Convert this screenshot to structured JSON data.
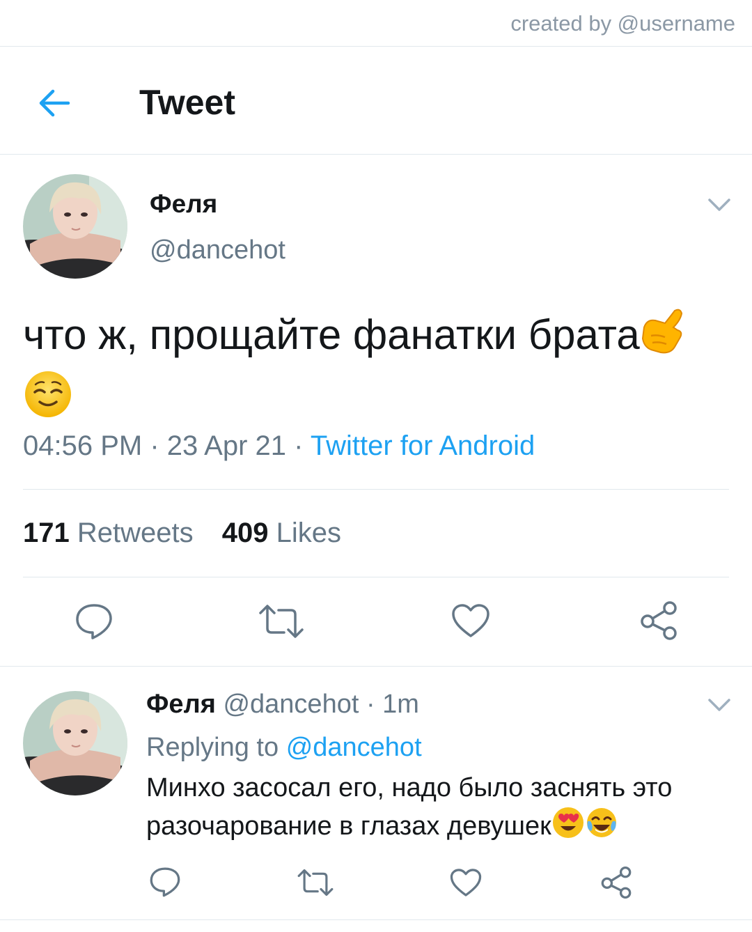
{
  "credit": "created by @username",
  "header": {
    "title": "Tweet",
    "back_icon": "arrow-left-icon"
  },
  "tweet": {
    "author_name": "Феля",
    "author_handle": "@dancehot",
    "text": "что ж, прощайте фанатки брата",
    "emojis": [
      "call-me-hand-emoji",
      "relieved-face-emoji"
    ],
    "time": "04:56 PM",
    "date": "23 Apr 21",
    "separator": " · ",
    "source": "Twitter for Android",
    "retweets_count": "171",
    "retweets_label": "Retweets",
    "likes_count": "409",
    "likes_label": "Likes"
  },
  "reply": {
    "author_name": "Феля",
    "author_handle": "@dancehot",
    "age": "· 1m",
    "replying_prefix": "Replying to",
    "replying_handle": "@dancehot",
    "text": "Минхо засосал его, надо было заснять это разочарование в глазах девушек",
    "emojis": [
      "heart-eyes-emoji",
      "tears-of-joy-emoji"
    ]
  },
  "colors": {
    "accent": "#1da1f2",
    "secondary_text": "#657786",
    "divider": "#e1e8ed",
    "primary_text": "#14171a"
  }
}
